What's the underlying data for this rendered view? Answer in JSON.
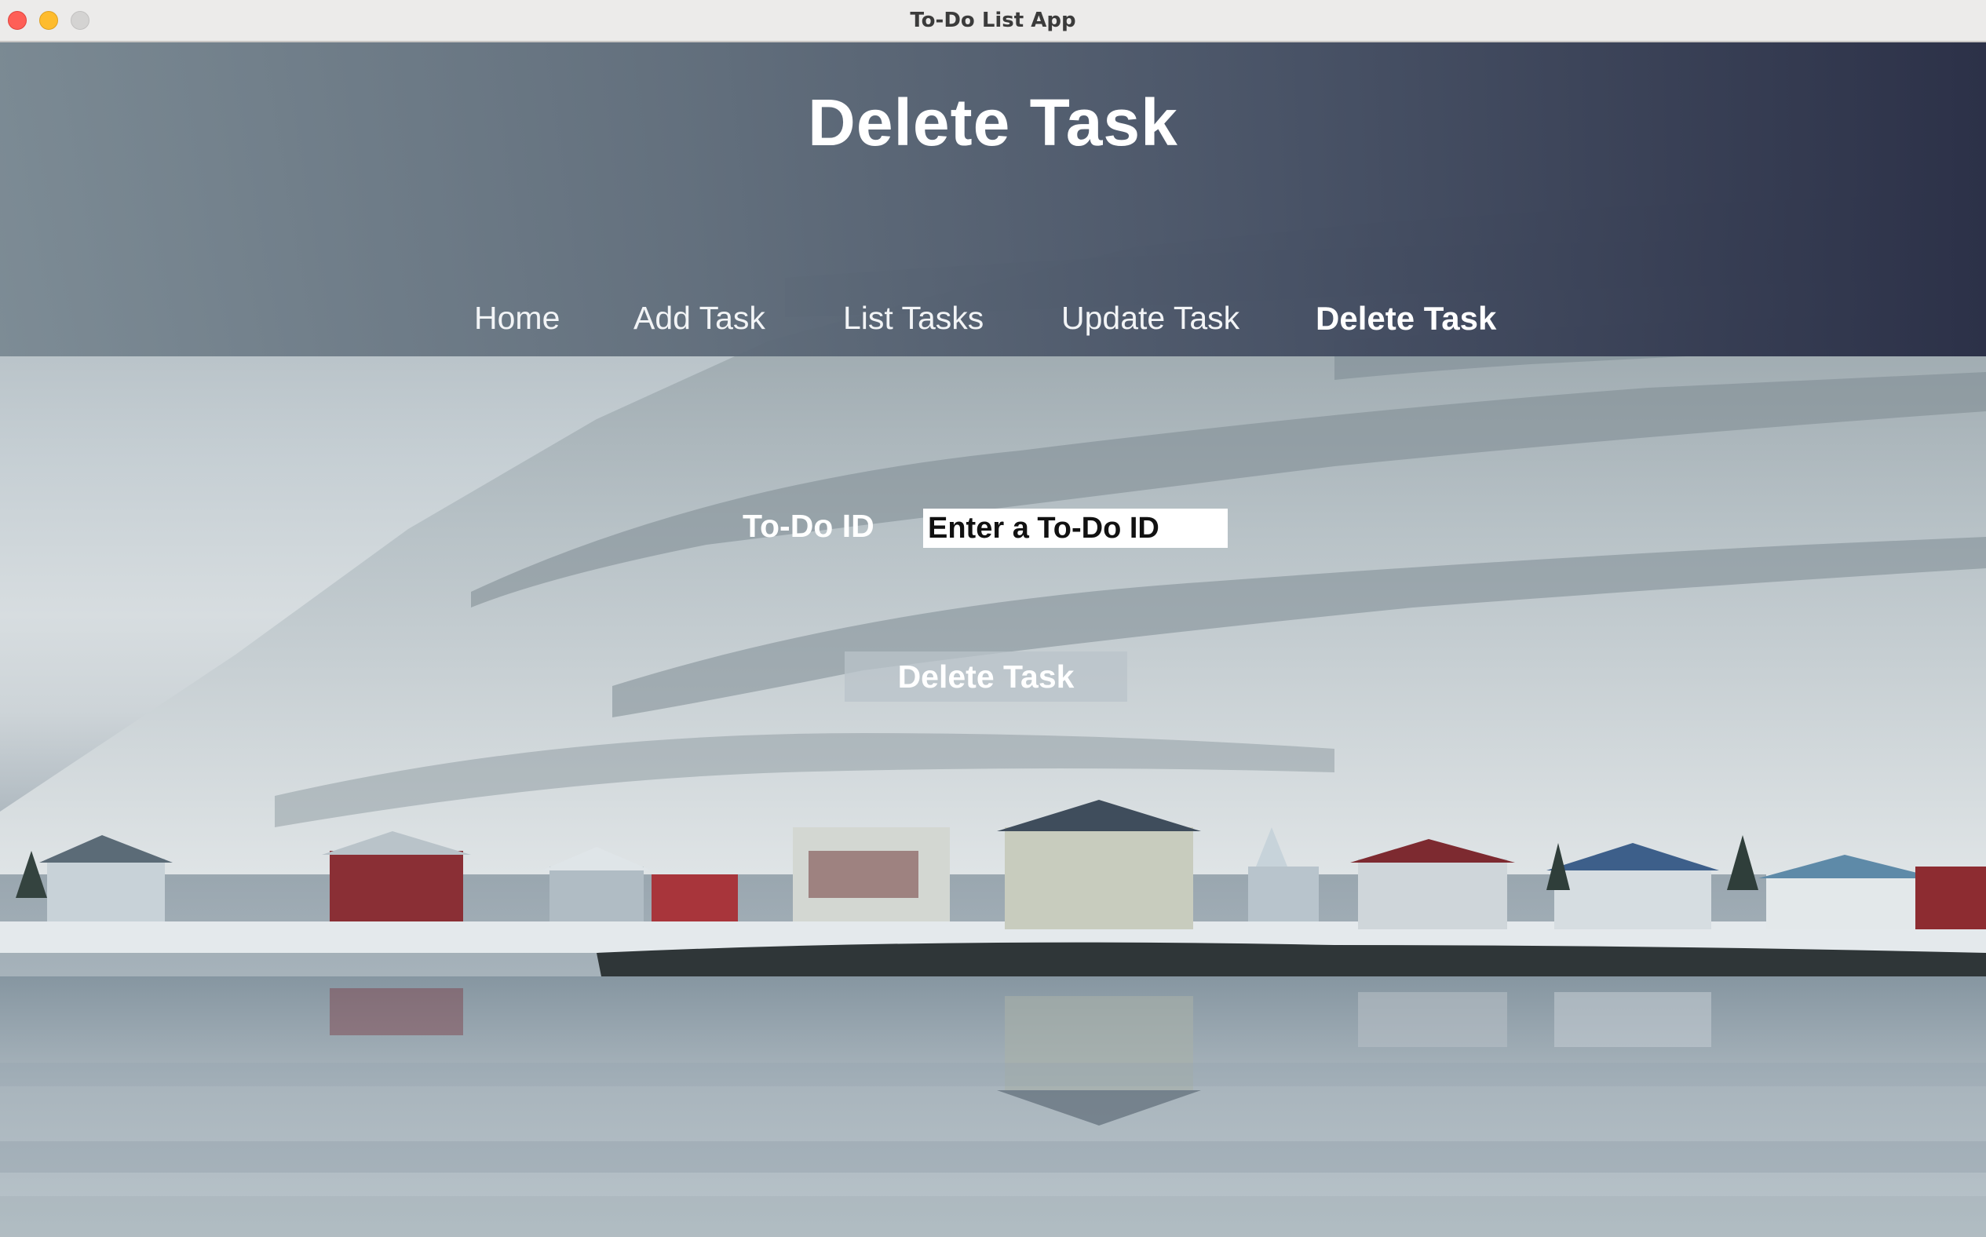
{
  "window": {
    "title": "To-Do List App"
  },
  "header": {
    "title": "Delete Task"
  },
  "nav": {
    "items": [
      {
        "label": "Home",
        "active": false
      },
      {
        "label": "Add Task",
        "active": false
      },
      {
        "label": "List Tasks",
        "active": false
      },
      {
        "label": "Update Task",
        "active": false
      },
      {
        "label": "Delete Task",
        "active": true
      }
    ]
  },
  "form": {
    "id_label": "To-Do ID",
    "id_placeholder": "Enter a To-Do ID",
    "id_value": "",
    "submit_label": "Delete Task"
  },
  "colors": {
    "header_gradient_start": "#7f8d96",
    "header_gradient_end": "#2c3148",
    "text": "#ffffff",
    "input_bg": "#ffffff"
  },
  "background": {
    "description_icon": "snowy-mountain-village-background"
  }
}
